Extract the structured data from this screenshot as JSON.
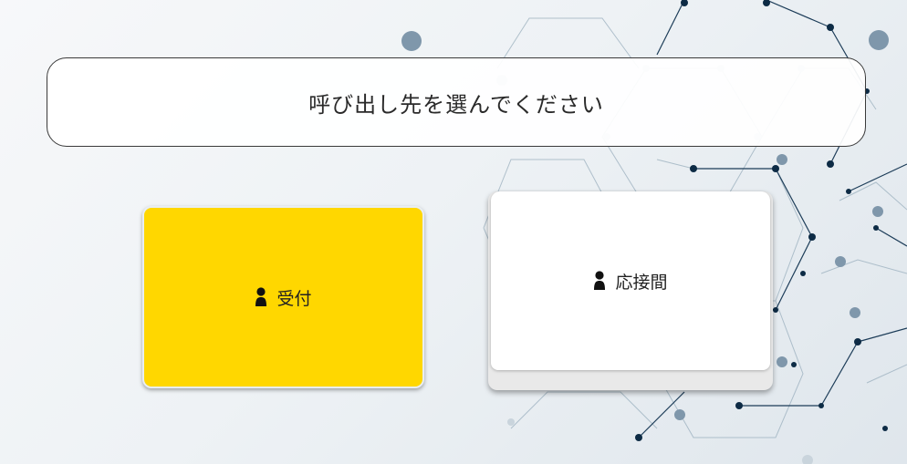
{
  "title": "呼び出し先を選んでください",
  "destinations": [
    {
      "label": "受付",
      "icon": "person-icon",
      "color": "#ffd700",
      "selected": true
    },
    {
      "label": "応接間",
      "icon": "person-icon",
      "color": "#ffffff",
      "selected": false
    }
  ],
  "colors": {
    "accent": "#ffd700",
    "network_dark": "#0d2b45",
    "network_light": "#b8c6d1"
  }
}
